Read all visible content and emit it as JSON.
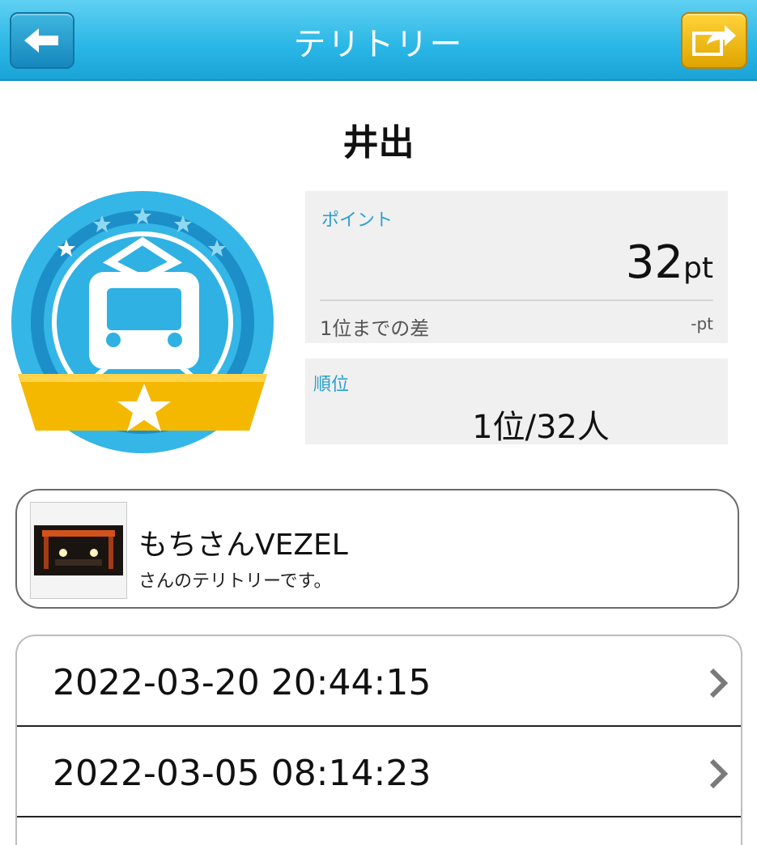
{
  "header": {
    "title": "テリトリー",
    "back_icon": "back-arrow-icon",
    "share_icon": "share-icon"
  },
  "territory": {
    "name": "井出",
    "points_label": "ポイント",
    "points_value": "32",
    "points_unit": "pt",
    "diff_label": "1位までの差",
    "diff_value": "-pt",
    "rank_label": "順位",
    "rank_value": "1位/32人"
  },
  "owner": {
    "name": "もちさんVEZEL",
    "subtitle": "さんのテリトリーです。"
  },
  "history": [
    {
      "datetime": "2022-03-20 20:44:15"
    },
    {
      "datetime": "2022-03-05 08:14:23"
    }
  ],
  "colors": {
    "header": "#29b6e6",
    "accent": "#2aa0cf",
    "share_button": "#f2be12",
    "badge_blue": "#29aee0",
    "ribbon": "#f5b800"
  }
}
